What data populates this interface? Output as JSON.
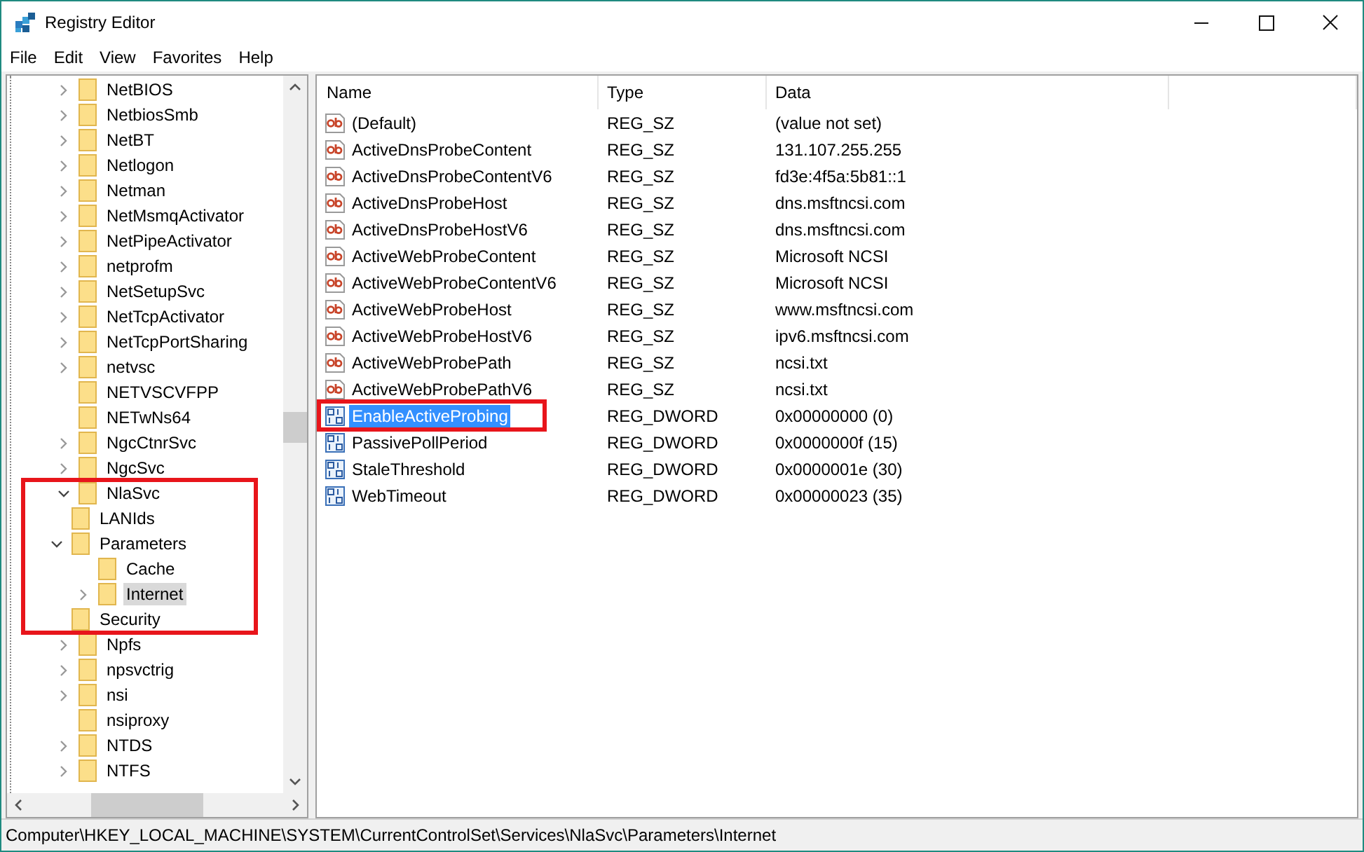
{
  "window": {
    "title": "Registry Editor"
  },
  "menu": [
    {
      "label": "File"
    },
    {
      "label": "Edit"
    },
    {
      "label": "View"
    },
    {
      "label": "Favorites"
    },
    {
      "label": "Help"
    }
  ],
  "tree": [
    {
      "label": "NetBIOS",
      "expanded": false,
      "selected": false
    },
    {
      "label": "NetbiosSmb",
      "expanded": false,
      "selected": false
    },
    {
      "label": "NetBT",
      "expanded": false,
      "selected": false
    },
    {
      "label": "Netlogon",
      "expanded": false,
      "selected": false
    },
    {
      "label": "Netman",
      "expanded": false,
      "selected": false
    },
    {
      "label": "NetMsmqActivator",
      "expanded": false,
      "selected": false
    },
    {
      "label": "NetPipeActivator",
      "expanded": false,
      "selected": false
    },
    {
      "label": "netprofm",
      "expanded": false,
      "selected": false
    },
    {
      "label": "NetSetupSvc",
      "expanded": false,
      "selected": false
    },
    {
      "label": "NetTcpActivator",
      "expanded": false,
      "selected": false
    },
    {
      "label": "NetTcpPortSharing",
      "expanded": false,
      "selected": false
    },
    {
      "label": "netvsc",
      "expanded": false,
      "selected": false
    },
    {
      "label": "NETVSCVFPP",
      "selected": false
    },
    {
      "label": "NETwNs64",
      "selected": false
    },
    {
      "label": "NgcCtnrSvc",
      "expanded": false,
      "selected": false
    },
    {
      "label": "NgcSvc",
      "expanded": false,
      "selected": false
    },
    {
      "label": "NlaSvc",
      "expanded": true,
      "selected": false,
      "annotated": true,
      "children": [
        {
          "label": "LANIds",
          "selected": false
        },
        {
          "label": "Parameters",
          "expanded": true,
          "selected": false,
          "children": [
            {
              "label": "Cache",
              "selected": false
            },
            {
              "label": "Internet",
              "expanded": false,
              "selected": true
            }
          ]
        },
        {
          "label": "Security",
          "selected": false
        }
      ]
    },
    {
      "label": "Npfs",
      "expanded": false,
      "selected": false
    },
    {
      "label": "npsvctrig",
      "expanded": false,
      "selected": false
    },
    {
      "label": "nsi",
      "expanded": false,
      "selected": false
    },
    {
      "label": "nsiproxy",
      "selected": false
    },
    {
      "label": "NTDS",
      "expanded": false,
      "selected": false
    },
    {
      "label": "NTFS",
      "expanded": false,
      "selected": false
    }
  ],
  "values": {
    "columns": [
      "Name",
      "Type",
      "Data"
    ],
    "rows": [
      {
        "kind": "string",
        "name": "(Default)",
        "type": "REG_SZ",
        "data": "(value not set)",
        "selected": false
      },
      {
        "kind": "string",
        "name": "ActiveDnsProbeContent",
        "type": "REG_SZ",
        "data": "131.107.255.255",
        "selected": false
      },
      {
        "kind": "string",
        "name": "ActiveDnsProbeContentV6",
        "type": "REG_SZ",
        "data": "fd3e:4f5a:5b81::1",
        "selected": false
      },
      {
        "kind": "string",
        "name": "ActiveDnsProbeHost",
        "type": "REG_SZ",
        "data": "dns.msftncsi.com",
        "selected": false
      },
      {
        "kind": "string",
        "name": "ActiveDnsProbeHostV6",
        "type": "REG_SZ",
        "data": "dns.msftncsi.com",
        "selected": false
      },
      {
        "kind": "string",
        "name": "ActiveWebProbeContent",
        "type": "REG_SZ",
        "data": "Microsoft NCSI",
        "selected": false
      },
      {
        "kind": "string",
        "name": "ActiveWebProbeContentV6",
        "type": "REG_SZ",
        "data": "Microsoft NCSI",
        "selected": false
      },
      {
        "kind": "string",
        "name": "ActiveWebProbeHost",
        "type": "REG_SZ",
        "data": "www.msftncsi.com",
        "selected": false
      },
      {
        "kind": "string",
        "name": "ActiveWebProbeHostV6",
        "type": "REG_SZ",
        "data": "ipv6.msftncsi.com",
        "selected": false
      },
      {
        "kind": "string",
        "name": "ActiveWebProbePath",
        "type": "REG_SZ",
        "data": "ncsi.txt",
        "selected": false
      },
      {
        "kind": "string",
        "name": "ActiveWebProbePathV6",
        "type": "REG_SZ",
        "data": "ncsi.txt",
        "selected": false
      },
      {
        "kind": "binary",
        "name": "EnableActiveProbing",
        "type": "REG_DWORD",
        "data": "0x00000000 (0)",
        "selected": true,
        "annotated": true
      },
      {
        "kind": "binary",
        "name": "PassivePollPeriod",
        "type": "REG_DWORD",
        "data": "0x0000000f (15)",
        "selected": false
      },
      {
        "kind": "binary",
        "name": "StaleThreshold",
        "type": "REG_DWORD",
        "data": "0x0000001e (30)",
        "selected": false
      },
      {
        "kind": "binary",
        "name": "WebTimeout",
        "type": "REG_DWORD",
        "data": "0x00000023 (35)",
        "selected": false
      }
    ]
  },
  "status_bar": {
    "path": "Computer\\HKEY_LOCAL_MACHINE\\SYSTEM\\CurrentControlSet\\Services\\NlaSvc\\Parameters\\Internet"
  }
}
